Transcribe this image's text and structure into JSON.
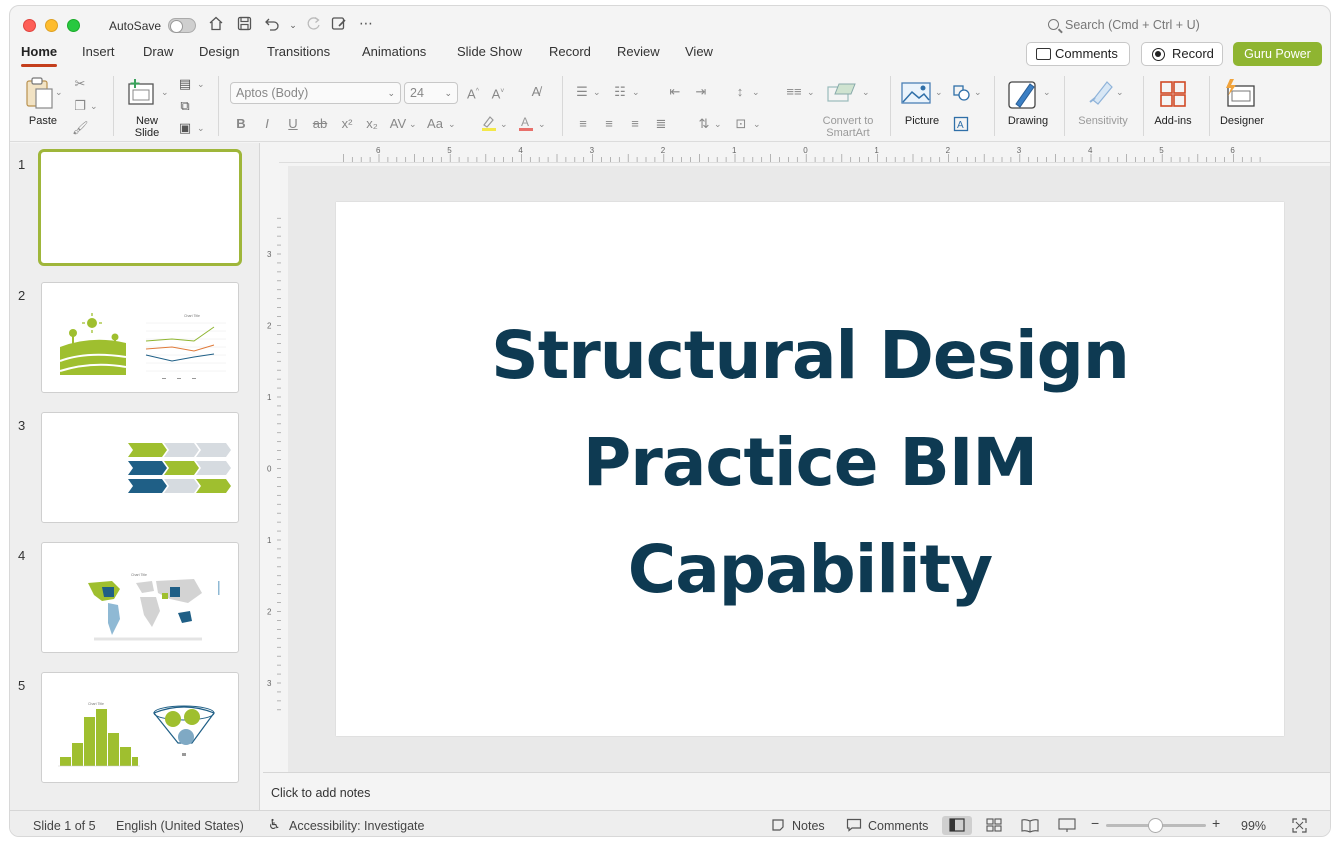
{
  "titlebar": {
    "autosave_label": "AutoSave",
    "search_placeholder": "Search (Cmd + Ctrl + U)"
  },
  "tabs": [
    {
      "label": "Home",
      "active": true
    },
    {
      "label": "Insert"
    },
    {
      "label": "Draw"
    },
    {
      "label": "Design"
    },
    {
      "label": "Transitions"
    },
    {
      "label": "Animations"
    },
    {
      "label": "Slide Show"
    },
    {
      "label": "Record"
    },
    {
      "label": "Review"
    },
    {
      "label": "View"
    }
  ],
  "header_buttons": {
    "comments": "Comments",
    "record": "Record",
    "guru": "Guru Power"
  },
  "ribbon": {
    "paste": "Paste",
    "new_slide": "New\nSlide",
    "font_name": "Aptos (Body)",
    "font_size": "24",
    "convert_smartart": "Convert to\nSmartArt",
    "picture": "Picture",
    "drawing": "Drawing",
    "sensitivity": "Sensitivity",
    "addins": "Add-ins",
    "designer": "Designer"
  },
  "thumbnails": [
    {
      "number": "1",
      "selected": true
    },
    {
      "number": "2",
      "chart_title": "Chart Title"
    },
    {
      "number": "3"
    },
    {
      "number": "4",
      "chart_title": "Chart Title"
    },
    {
      "number": "5",
      "chart_title": "Chart Title"
    }
  ],
  "slide": {
    "title_lines": [
      "Structural Design",
      "Practice BIM",
      "Capability"
    ]
  },
  "notes_placeholder": "Click to add notes",
  "statusbar": {
    "slide_count": "Slide 1 of 5",
    "language": "English (United States)",
    "accessibility": "Accessibility: Investigate",
    "notes": "Notes",
    "comments": "Comments",
    "zoom": "99%",
    "zoom_level_fraction": 0.5
  },
  "ruler": {
    "h_labels": [
      "6",
      "5",
      "4",
      "3",
      "2",
      "1",
      "0",
      "1",
      "2",
      "3",
      "4",
      "5",
      "6"
    ],
    "v_labels": [
      "3",
      "2",
      "1",
      "0",
      "1",
      "2",
      "3"
    ]
  },
  "colors": {
    "accent_red": "#c43e1c",
    "guru_green": "#8fb531",
    "title_navy": "#0e3a52",
    "thumb_green": "#9fbf2f",
    "thumb_blue": "#1f5f86"
  }
}
